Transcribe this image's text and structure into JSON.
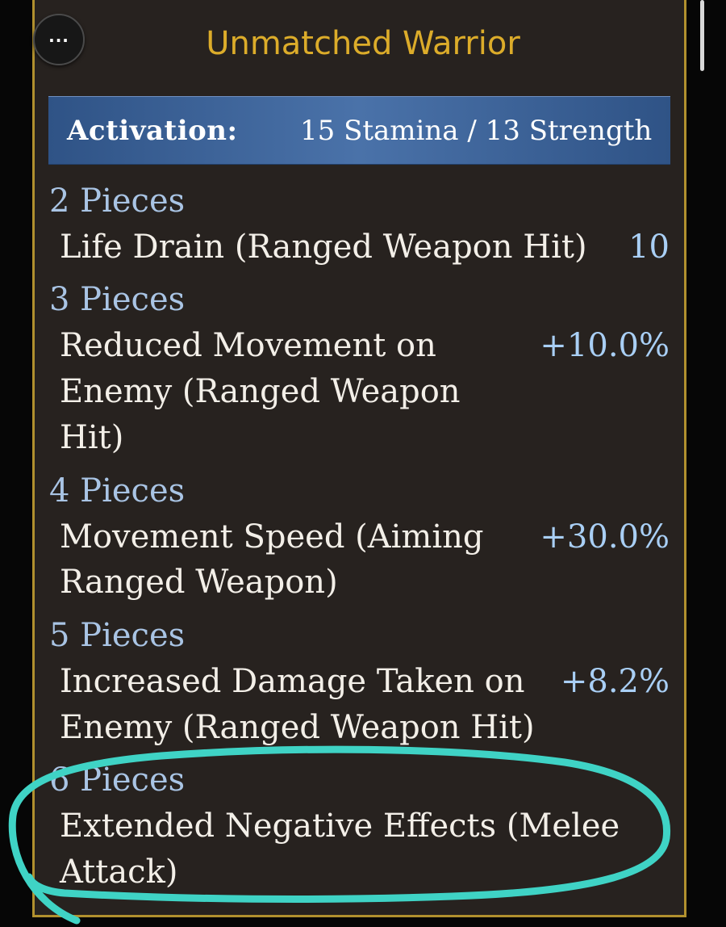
{
  "header": {
    "menu_label": "...",
    "title": "Unmatched Warrior"
  },
  "activation": {
    "label": "Activation:",
    "value": "15 Stamina / 13 Strength"
  },
  "set_bonuses": [
    {
      "header": "2 Pieces",
      "lines": [
        "Life Drain (Ranged Weapon Hit)"
      ],
      "value": "10"
    },
    {
      "header": "3 Pieces",
      "lines": [
        "Reduced Movement on",
        "Enemy (Ranged Weapon",
        "Hit)"
      ],
      "value": "+10.0%"
    },
    {
      "header": "4 Pieces",
      "lines": [
        "Movement Speed (Aiming",
        "Ranged Weapon)"
      ],
      "value": "+30.0%"
    },
    {
      "header": "5 Pieces",
      "lines": [
        "Increased Damage Taken on",
        "Enemy (Ranged Weapon Hit)"
      ],
      "value": "+8.2%"
    },
    {
      "header": "6 Pieces",
      "lines": [
        "Extended Negative Effects (Melee",
        "Attack)"
      ],
      "value": ""
    }
  ],
  "colors": {
    "title": "#dcac2a",
    "panel_border": "#b1902e",
    "panel_background": "#27221f",
    "activation_bar": "#3c639a",
    "piece_header": "#a9c4e4",
    "bonus_value": "#a9cff5",
    "annotation_circle": "#3fd3c5"
  },
  "icons": {
    "menu": "more-horizontal-icon"
  }
}
